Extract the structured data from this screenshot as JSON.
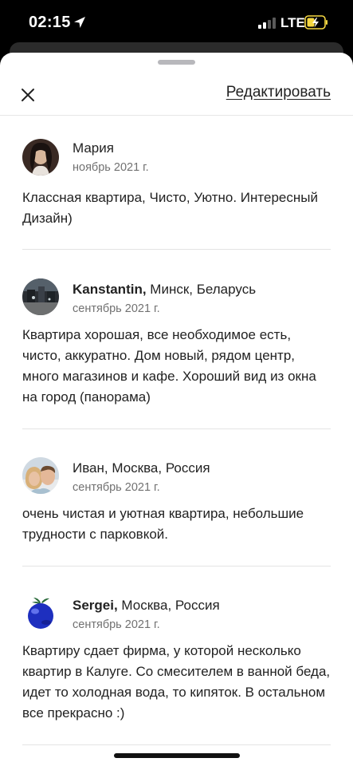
{
  "status_bar": {
    "time": "02:15",
    "network": "LTE",
    "location_icon": "location-arrow-icon",
    "signal_icon": "cellular-signal-icon",
    "battery_icon": "battery-charging-icon",
    "battery_color": "#f5d742"
  },
  "header": {
    "close_icon": "close-icon",
    "edit_label": "Редактировать"
  },
  "reviews": [
    {
      "name": "Мария",
      "location": "",
      "date": "ноябрь 2021 г.",
      "text": "Классная квартира, Чисто, Уютно. Интересный Дизайн)"
    },
    {
      "name": "Kanstantin,",
      "location": " Минск, Беларусь",
      "date": "сентябрь 2021 г.",
      "text": "Квартира хорошая, все необходимое есть, чисто, аккуратно. Дом новый, рядом центр, много магазинов и кафе. Хороший вид из окна на город (панорама)"
    },
    {
      "name": "Иван, Москва, Россия",
      "location": "",
      "date": "сентябрь 2021 г.",
      "text": "очень чистая и уютная квартира, небольшие трудности с парковкой."
    },
    {
      "name": "Sergei,",
      "location": " Москва, Россия",
      "date": "сентябрь 2021 г.",
      "text": "Квартиру сдает фирма, у которой несколько квартир в Калуге. Со смесителем в ванной беда, идет то холодная вода, то кипяток. В остальном все прекрасно :)"
    }
  ]
}
